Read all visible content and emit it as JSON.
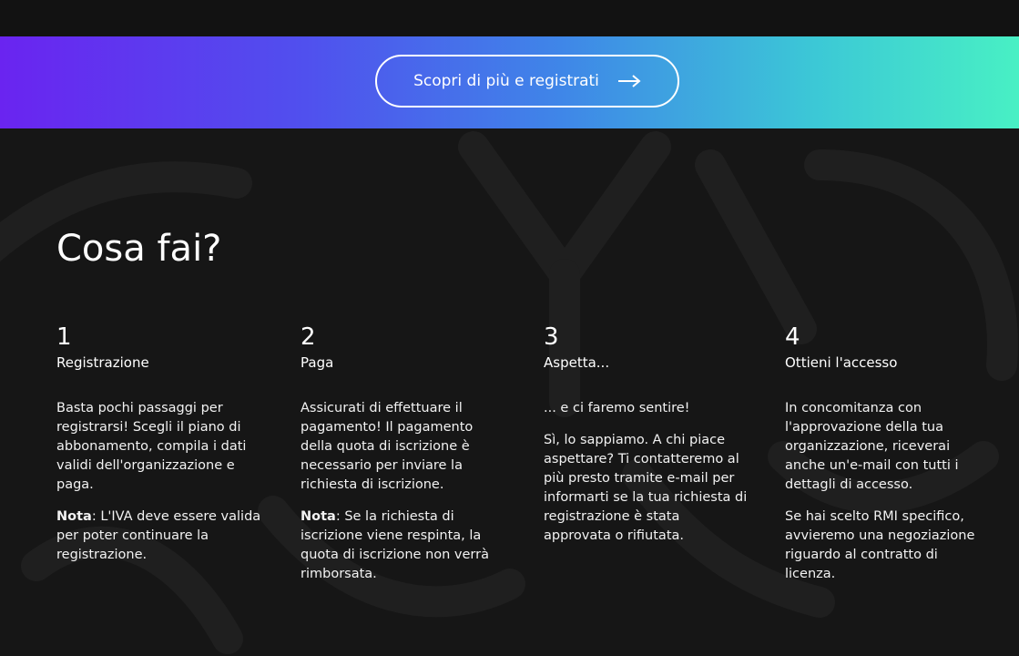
{
  "banner": {
    "cta_label": "Scopri di più e registrati"
  },
  "section": {
    "title": "Cosa fai?"
  },
  "steps": [
    {
      "number": "1",
      "title": "Registrazione",
      "paragraph1": "Basta pochi passaggi per registrarsi! Scegli il piano di abbonamento, compila i dati validi dell'organizzazione e paga.",
      "note_label": "Nota",
      "note_text": ": L'IVA deve essere valida per poter continuare la registrazione."
    },
    {
      "number": "2",
      "title": "Paga",
      "paragraph1": "Assicurati di effettuare il pagamento! Il pagamento della quota di iscrizione è necessario per inviare la richiesta di iscrizione.",
      "note_label": "Nota",
      "note_text": ": Se la richiesta di iscrizione viene respinta, la quota di iscrizione non verrà rimborsata."
    },
    {
      "number": "3",
      "title": "Aspetta...",
      "paragraph1": "... e ci faremo sentire!",
      "paragraph2": "Sì, lo sappiamo. A chi piace aspettare? Ti contatteremo al più presto tramite e-mail per informarti se la tua richiesta di registrazione è stata approvata o rifiutata."
    },
    {
      "number": "4",
      "title": "Ottieni l'accesso",
      "paragraph1": "In concomitanza con l'approvazione della tua organizzazione, riceverai anche un'e-mail con tutti i dettagli di accesso.",
      "paragraph2": "Se hai scelto RMI specifico, avvieremo una negoziazione riguardo al contratto di licenza."
    }
  ]
}
